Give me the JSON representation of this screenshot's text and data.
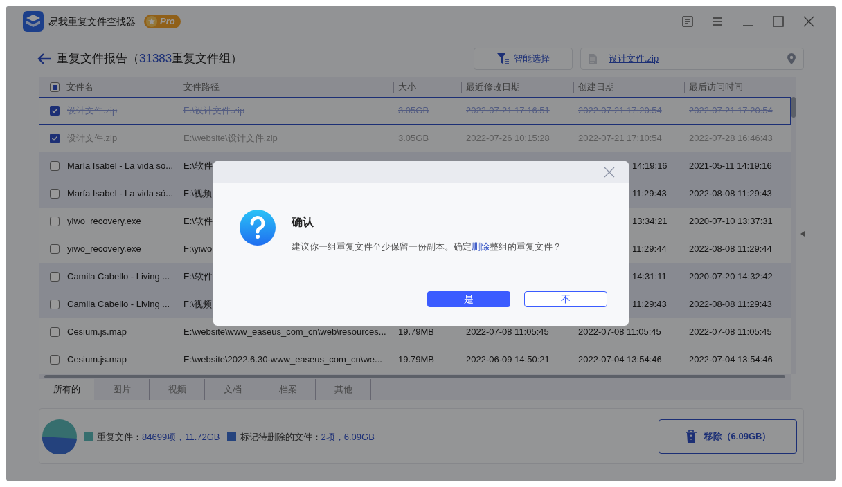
{
  "window": {
    "title": "易我重复文件查找器",
    "badge": "Pro"
  },
  "header": {
    "title_prefix": "重复文件报告（",
    "count": "31383",
    "title_suffix": "重复文件组）",
    "smart_select": "智能选择",
    "file_link": "设计文件.zip"
  },
  "table": {
    "columns": [
      "文件名",
      "文件路径",
      "大小",
      "最近修改日期",
      "创建日期",
      "最后访问时间"
    ],
    "select_all": {
      "partial": true
    },
    "rows": [
      {
        "kind": "full",
        "checked": true,
        "selected": true,
        "struck": true,
        "shaded": false,
        "cells": [
          "设计文件.zip",
          "E:\\设计文件.zip",
          "3.05GB",
          "2022-07-21 17:16:51",
          "2022-07-21 17:20:54",
          "2022-07-21 17:20:54"
        ]
      },
      {
        "kind": "full",
        "checked": true,
        "selected": false,
        "struck": true,
        "shaded": false,
        "cells": [
          "设计文件.zip",
          "E:\\website\\设计文件.zip",
          "3.05GB",
          "2022-07-26 10:15:28",
          "2022-07-21 17:10:54",
          "2022-07-28 16:46:43"
        ]
      },
      {
        "kind": "covered",
        "checked": false,
        "selected": false,
        "struck": false,
        "shaded": true,
        "cells": [
          "María Isabel - La vida só...",
          "E:\\软件",
          "14:19:16",
          "2021-05-11 14:19:16"
        ]
      },
      {
        "kind": "covered",
        "checked": false,
        "selected": false,
        "struck": false,
        "shaded": true,
        "cells": [
          "María Isabel - La vida só...",
          "F:\\视频",
          "11:29:43",
          "2022-08-08 11:29:43"
        ]
      },
      {
        "kind": "covered",
        "checked": false,
        "selected": false,
        "struck": false,
        "shaded": false,
        "cells": [
          "yiwo_recovery.exe",
          "E:\\软件",
          "13:34:21",
          "2020-07-10 13:37:31"
        ]
      },
      {
        "kind": "covered",
        "checked": false,
        "selected": false,
        "struck": false,
        "shaded": false,
        "cells": [
          "yiwo_recovery.exe",
          "F:\\yiwo",
          "11:29:44",
          "2022-08-08 11:29:44"
        ]
      },
      {
        "kind": "covered",
        "checked": false,
        "selected": false,
        "struck": false,
        "shaded": true,
        "cells": [
          "Camila Cabello - Living ...",
          "E:\\软件",
          "14:31:11",
          "2020-07-20 14:32:42"
        ]
      },
      {
        "kind": "covered",
        "checked": false,
        "selected": false,
        "struck": false,
        "shaded": true,
        "cells": [
          "Camila Cabello - Living ...",
          "F:\\视频",
          "11:29:43",
          "2022-08-08 11:29:43"
        ]
      },
      {
        "kind": "full",
        "checked": false,
        "selected": false,
        "struck": false,
        "shaded": false,
        "cells": [
          "Cesium.js.map",
          "E:\\website\\www_easeus_com_cn\\web\\resources...",
          "19.79MB",
          "2022-07-08 11:05:45",
          "2022-07-08 11:05:45",
          "2022-07-08 11:05:45"
        ]
      },
      {
        "kind": "full",
        "checked": false,
        "selected": false,
        "struck": false,
        "shaded": false,
        "cells": [
          "Cesium.js.map",
          "E:\\website\\2022.6.30-www_easeus_com_cn\\we...",
          "19.79MB",
          "2022-06-09 14:50:21",
          "2022-07-04 13:54:46",
          "2022-07-04 13:54:46"
        ]
      }
    ]
  },
  "tabs": [
    {
      "label": "所有的",
      "selected": true
    },
    {
      "label": "图片",
      "selected": false
    },
    {
      "label": "视频",
      "selected": false
    },
    {
      "label": "文档",
      "selected": false
    },
    {
      "label": "档案",
      "selected": false
    },
    {
      "label": "其他",
      "selected": false
    }
  ],
  "summary": {
    "legend": [
      {
        "label": "重复文件：",
        "value": "84699项，11.72GB",
        "color": "#366e6e"
      },
      {
        "label": "标记待删除的文件：",
        "value": "2项，6.09GB",
        "color": "#25437d"
      }
    ],
    "remove_button": "移除（6.09GB）"
  },
  "dialog": {
    "title": "确认",
    "message_before": "建议你一组重复文件至少保留一份副本。确定",
    "message_link": "删除",
    "message_after": "整组的重复文件？",
    "buttons": [
      {
        "label": "是",
        "primary": true
      },
      {
        "label": "不",
        "primary": false
      }
    ]
  }
}
